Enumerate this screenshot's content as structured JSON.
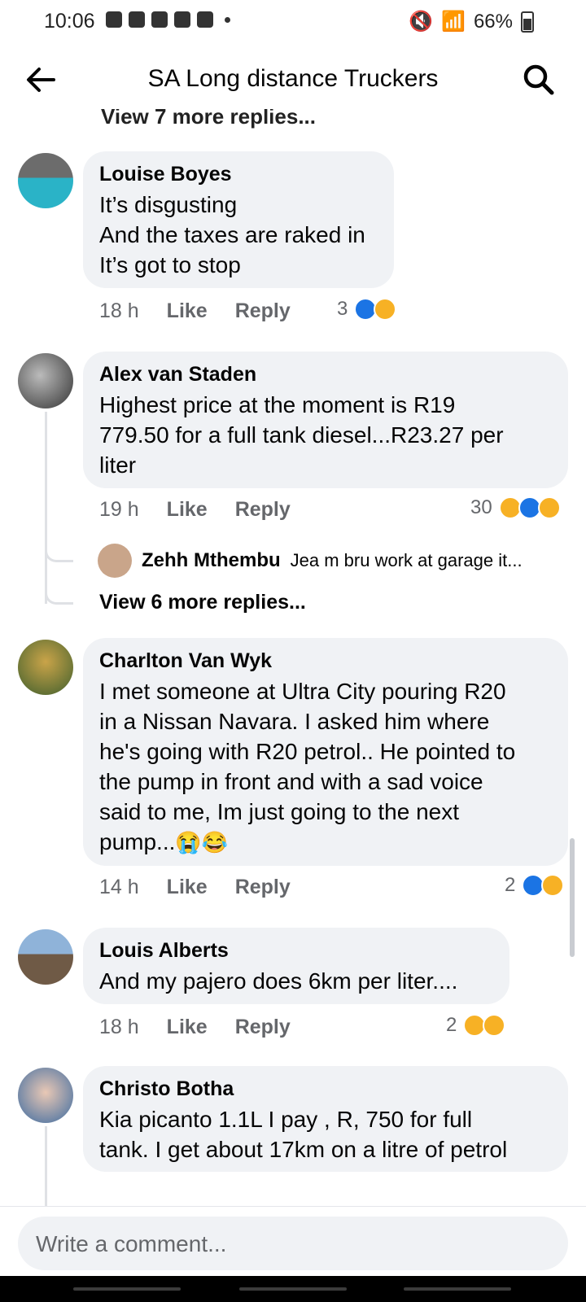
{
  "status_bar": {
    "time": "10:06",
    "battery": "66%"
  },
  "header": {
    "title": "SA Long distance Truckers"
  },
  "feed": {
    "cut_more_replies": "View 7 more replies...",
    "comments": [
      {
        "author": "Louise Boyes",
        "text": "It’s disgusting\nAnd the taxes are raked in\nIt’s got to stop",
        "time": "18 h",
        "like": "Like",
        "reply": "Reply",
        "reactions": "3"
      },
      {
        "author": "Alex van Staden",
        "text": "Highest price at the moment is R19\n779.50 for  a full tank diesel...R23.27 per\nliter",
        "time": "19 h",
        "like": "Like",
        "reply": "Reply",
        "reactions": "30",
        "sub_reply": {
          "author": "Zehh Mthembu",
          "text": "Jea m bru work at garage it..."
        },
        "more_replies": "View 6 more replies..."
      },
      {
        "author": "Charlton Van Wyk",
        "text": "I met someone at Ultra City pouring R20\nin a Nissan Navara. I asked him where\nhe's going with R20 petrol.. He pointed to\nthe pump in front and with a sad voice\nsaid to me, Im just going to the next\npump...",
        "time": "14 h",
        "like": "Like",
        "reply": "Reply",
        "reactions": "2"
      },
      {
        "author": "Louis Alberts",
        "text": "And my pajero does 6km per liter....",
        "time": "18 h",
        "like": "Like",
        "reply": "Reply",
        "reactions": "2"
      },
      {
        "author": "Christo Botha",
        "text": "Kia picanto 1.1L I pay , R, 750 for full\ntank. I get about 17km on a litre of petrol"
      }
    ]
  },
  "composer": {
    "placeholder": "Write a comment..."
  },
  "colors": {
    "bubble": "#f0f2f5",
    "like_blue": "#1b74e4",
    "meta_gray": "#65676b"
  }
}
